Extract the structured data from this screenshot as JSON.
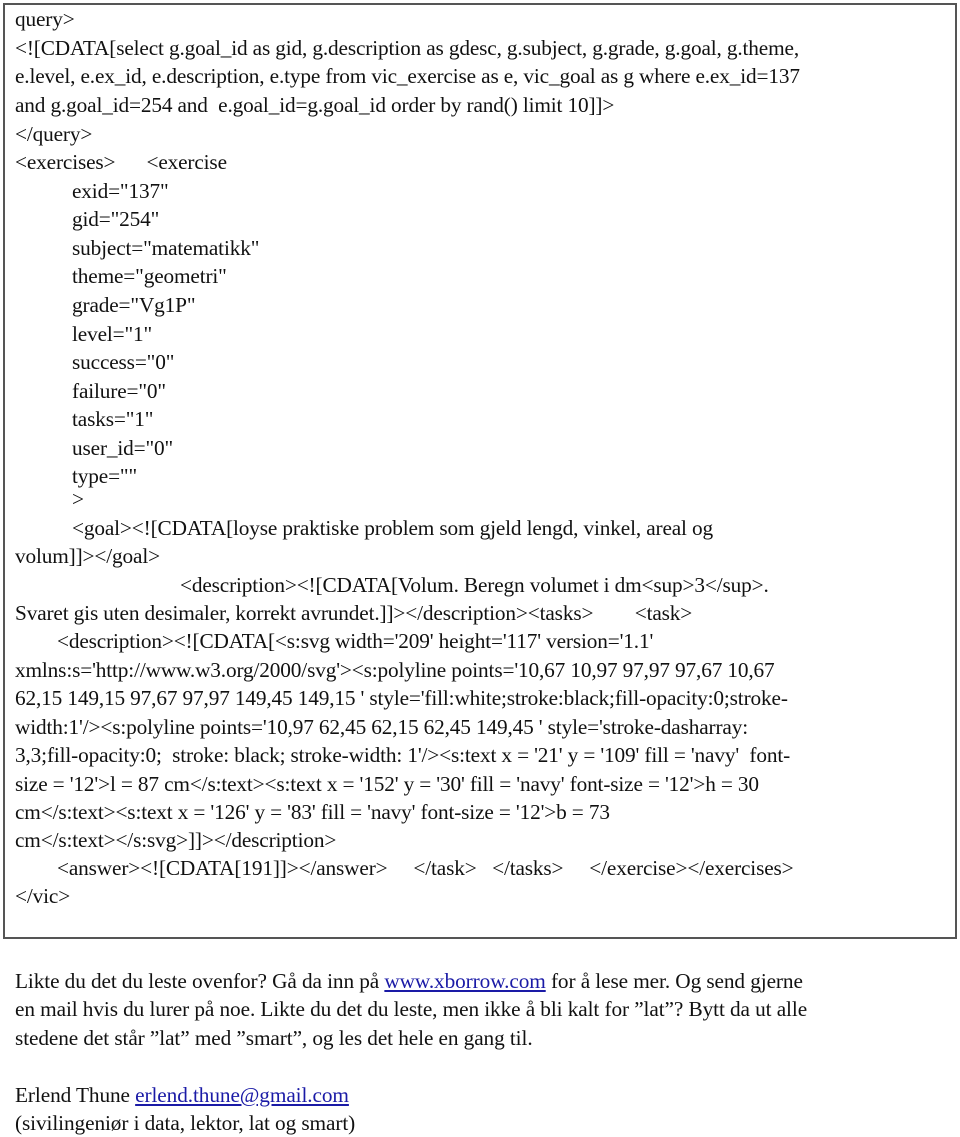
{
  "code_box": {
    "lines": [
      "query>",
      "<![CDATA[select g.goal_id as gid, g.description as gdesc, g.subject, g.grade, g.goal, g.theme,",
      "e.level, e.ex_id, e.description, e.type from vic_exercise as e, vic_goal as g where e.ex_id=137",
      "and g.goal_id=254 and  e.goal_id=g.goal_id order by rand() limit 10]]>",
      "</query>",
      "<exercises>      <exercise",
      "exid=\"137\"",
      "gid=\"254\"",
      "subject=\"matematikk\"",
      "theme=\"geometri\"",
      "grade=\"Vg1P\"",
      "level=\"1\"",
      "success=\"0\"",
      "failure=\"0\"",
      "tasks=\"1\"",
      "user_id=\"0\"",
      "type=\"\"",
      ">",
      "<goal><![CDATA[loyse praktiske problem som gjeld lengd, vinkel, areal og",
      "volum]]></goal>",
      "<description><![CDATA[Volum. Beregn volumet i dm<sup>3</sup>.",
      "Svaret gis uten desimaler, korrekt avrundet.]]></description><tasks>        <task>",
      "<description><![CDATA[<s:svg width='209' height='117' version='1.1'",
      "xmlns:s='http://www.w3.org/2000/svg'><s:polyline points='10,67 10,97 97,97 97,67 10,67",
      "62,15 149,15 97,67 97,97 149,45 149,15 ' style='fill:white;stroke:black;fill-opacity:0;stroke-",
      "width:1'/><s:polyline points='10,97 62,45 62,15 62,45 149,45 ' style='stroke-dasharray:",
      "3,3;fill-opacity:0;  stroke: black; stroke-width: 1'/><s:text x = '21' y = '109' fill = 'navy'  font-",
      "size = '12'>l = 87 cm</s:text><s:text x = '152' y = '30' fill = 'navy' font-size = '12'>h = 30",
      "cm</s:text><s:text x = '126' y = '83' fill = 'navy' font-size = '12'>b = 73",
      "cm</s:text></s:svg>]]></description>",
      "<answer><![CDATA[191]]></answer>     </task>   </tasks>     </exercise></exercises>",
      "</vic>"
    ]
  },
  "footer": {
    "p1_a": "Likte du det du leste ovenfor? Gå da inn på ",
    "p1_link": "www.xborrow.com",
    "p1_b": " for å lese mer. Og send gjerne",
    "p1_line2": "en mail hvis du lurer på noe. Likte du det du leste, men ikke å bli kalt for ”lat”? Bytt da ut alle",
    "p1_line3": "stedene det står ”lat” med ”smart”, og les det hele en gang til.",
    "author_name": "Erlend Thune ",
    "author_email": "erlend.thune@gmail.com",
    "author_title": "(sivilingeniør i data, lektor, lat og smart)"
  },
  "colors": {
    "link": "#1a1aa6",
    "border": "#555555"
  }
}
